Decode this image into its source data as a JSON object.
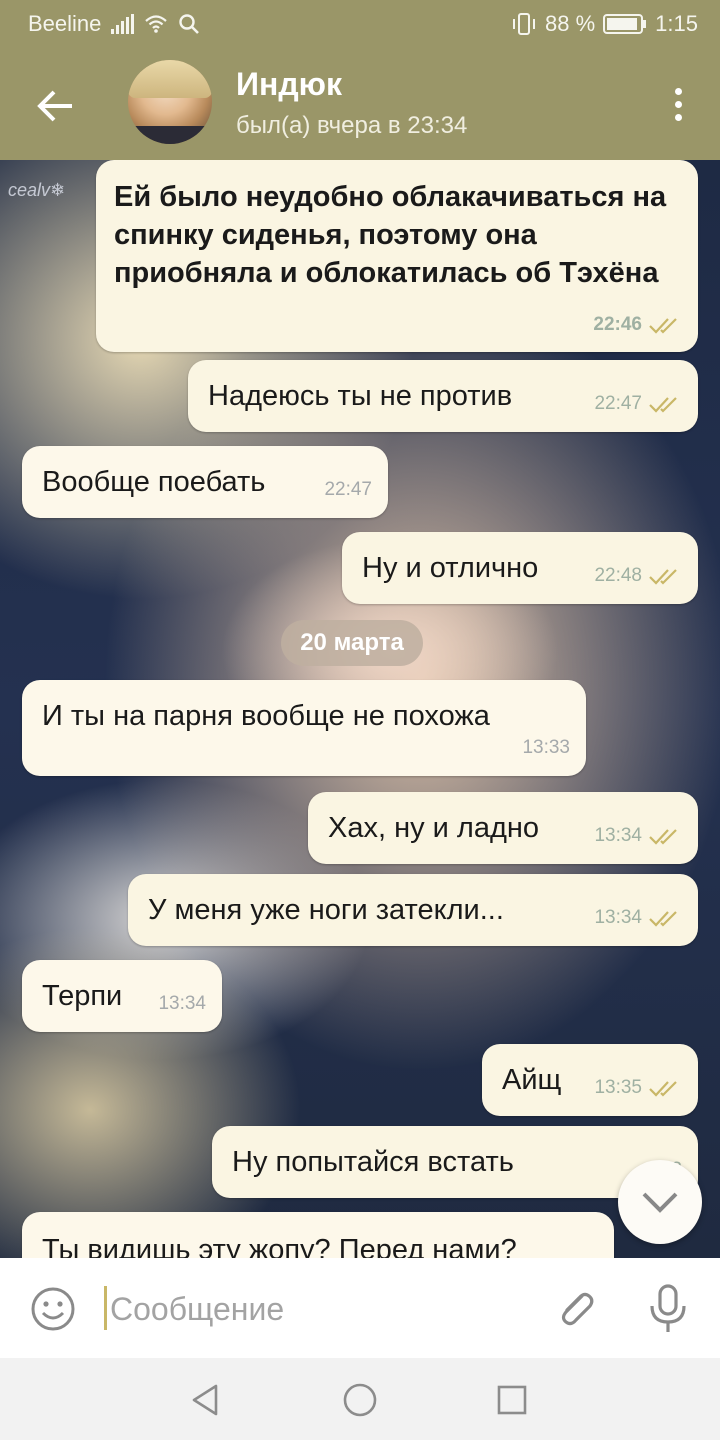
{
  "status_bar": {
    "carrier": "Beeline",
    "battery": "88 %",
    "time": "1:15"
  },
  "header": {
    "contact_name": "Индюк",
    "last_seen": "был(а) вчера в 23:34"
  },
  "wallpaper": {
    "watermark": "cealv❄"
  },
  "messages": [
    {
      "direction": "out",
      "text": "Ей было неудобно облакачиваться на спинку сиденья, поэтому она приобняла и облокатилась об Тэхёна",
      "time": "22:46",
      "read": true
    },
    {
      "direction": "out",
      "text": "Надеюсь ты не против",
      "time": "22:47",
      "read": true
    },
    {
      "direction": "in",
      "text": "Вообще поебать",
      "time": "22:47"
    },
    {
      "direction": "out",
      "text": "Ну и отлично",
      "time": "22:48",
      "read": true
    },
    {
      "direction": "in",
      "text": "И ты на парня вообще не похожа",
      "time": "13:33"
    },
    {
      "direction": "out",
      "text": "Хах, ну и ладно",
      "time": "13:34",
      "read": true
    },
    {
      "direction": "out",
      "text": "У меня уже ноги затекли...",
      "time": "13:34",
      "read": true
    },
    {
      "direction": "in",
      "text": "Терпи",
      "time": "13:34"
    },
    {
      "direction": "out",
      "text": "Айщ",
      "time": "13:35",
      "read": true
    },
    {
      "direction": "out",
      "text": "Ну попытайся встать",
      "time": "13:3"
    },
    {
      "direction": "in",
      "text": "Ты видишь эту жопу? Перед нами?"
    }
  ],
  "date_separator": "20 марта",
  "input": {
    "placeholder": "Сообщение"
  },
  "colors": {
    "header": "#9a9668",
    "outgoing_bubble": "#faf5e2",
    "incoming_bubble": "#fdf8ea",
    "read_check": "#c9b767",
    "input_caret": "#c9b767"
  },
  "icons": [
    "back-arrow-icon",
    "more-vert-icon",
    "emoji-icon",
    "paperclip-icon",
    "microphone-icon",
    "chevron-down-icon",
    "nav-back-icon",
    "nav-home-icon",
    "nav-recents-icon"
  ]
}
